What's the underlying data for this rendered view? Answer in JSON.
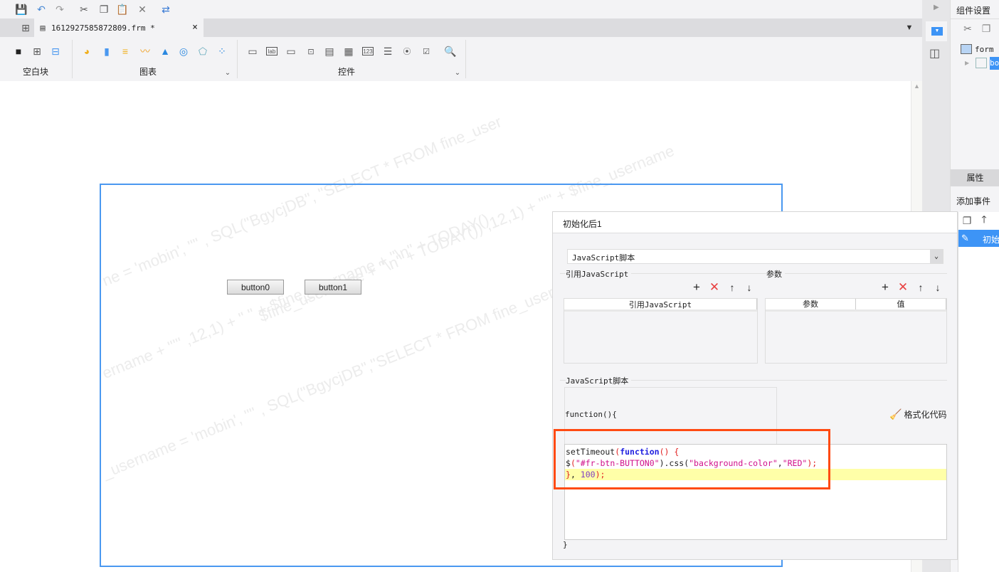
{
  "toolbar": {
    "icons": [
      "save-icon",
      "undo-icon",
      "redo-icon",
      "cut-icon",
      "copy-icon",
      "paste-icon",
      "delete-icon",
      "refresh-icon"
    ]
  },
  "tab": {
    "title": "1612927585872809.frm *",
    "close": "×"
  },
  "ribbon": {
    "groups": [
      {
        "label": "空白块"
      },
      {
        "label": "图表"
      },
      {
        "label": "控件"
      }
    ],
    "control_icons": [
      "lab",
      "123"
    ]
  },
  "form": {
    "buttons": [
      "button0",
      "button1"
    ],
    "watermark": [
      "ne = 'mobin', \"\" , SQL(\"BgycjDB\", \"SELECT * FROM fine_user",
      "$fine_username + \"\\n\" + TODAY()) ,12,1) + \"'\" + $fine_username",
      "ername + \"'\" ,12,1) + \" \" + $fine_username + \"\\n\" + TODAY()",
      "_username = 'mobin', \"\" , SQL(\"BgycjDB\",\"SELECT * FROM fine_user w"
    ]
  },
  "right_panel": {
    "title": "组件设置",
    "tree": [
      "form",
      "bo"
    ],
    "tab_properties": "属性",
    "add_event": "添加事件",
    "event_item": "初始"
  },
  "dialog": {
    "title": "初始化后1",
    "type_select": "JavaScript脚本",
    "ref_js_label": "引用JavaScript",
    "params_label": "参数",
    "ref_table_headers": [
      "引用JavaScript"
    ],
    "param_table_headers": [
      "参数",
      "值"
    ],
    "script_label": "JavaScript脚本",
    "func_open": "function(){",
    "format_code": "格式化代码",
    "func_close": "}",
    "code": {
      "l1a": "setTimeout",
      "l1b": "(",
      "l1c": "function",
      "l1d": "() {",
      "l2a": "$",
      "l2b": "(",
      "l2c": "\"#fr-btn-BUTTON0\"",
      "l2d": ").css(",
      "l2e": "\"background-color\"",
      "l2f": ",",
      "l2g": "\"RED\"",
      "l2h": ");",
      "l3a": "}",
      "l3b": ", ",
      "l3c": "100",
      "l3d": ");"
    }
  },
  "colors": {
    "accent": "#4a98f0",
    "highlight": "#ff4a12",
    "selected": "#3d94f6"
  }
}
